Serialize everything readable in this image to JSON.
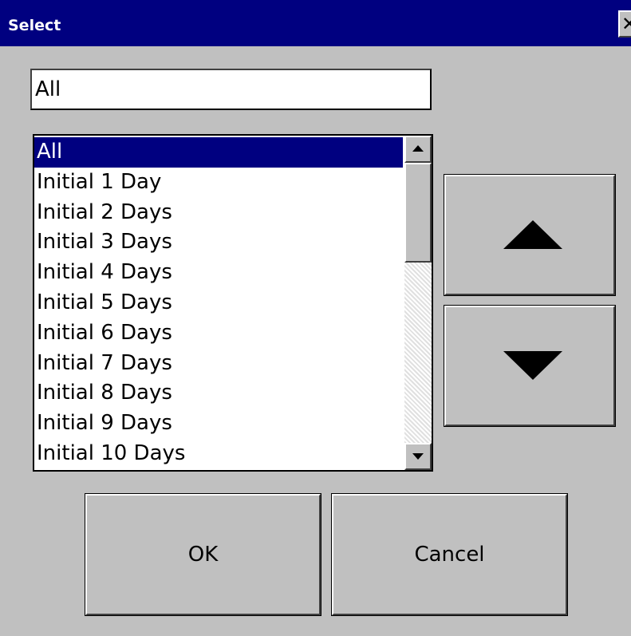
{
  "window": {
    "title": "Select",
    "close_glyph": "✕"
  },
  "text_field": {
    "value": "All"
  },
  "list": {
    "items": [
      {
        "label": "All",
        "selected": true
      },
      {
        "label": "Initial 1 Day",
        "selected": false
      },
      {
        "label": "Initial 2 Days",
        "selected": false
      },
      {
        "label": "Initial 3 Days",
        "selected": false
      },
      {
        "label": "Initial 4 Days",
        "selected": false
      },
      {
        "label": "Initial 5 Days",
        "selected": false
      },
      {
        "label": "Initial 6 Days",
        "selected": false
      },
      {
        "label": "Initial 7 Days",
        "selected": false
      },
      {
        "label": "Initial 8 Days",
        "selected": false
      },
      {
        "label": "Initial 9 Days",
        "selected": false
      },
      {
        "label": "Initial 10 Days",
        "selected": false
      }
    ]
  },
  "buttons": {
    "ok_label": "OK",
    "cancel_label": "Cancel",
    "up_icon": "triangle-up-icon",
    "down_icon": "triangle-down-icon"
  },
  "colors": {
    "titlebar": "#000080",
    "selection": "#000080",
    "face": "#c0c0c0"
  }
}
